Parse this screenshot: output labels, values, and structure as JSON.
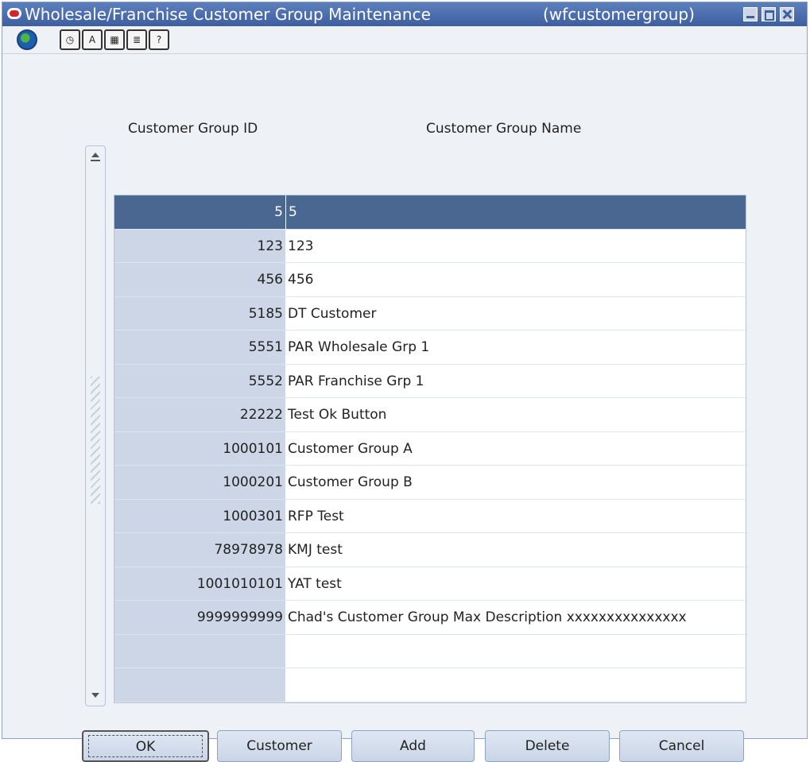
{
  "window": {
    "title": "Wholesale/Franchise Customer Group Maintenance",
    "form_id": "(wfcustomergroup)"
  },
  "toolbar": {
    "icons": [
      "globe-icon",
      "clock-icon",
      "font-icon",
      "calendar-icon",
      "notes-icon",
      "help-icon"
    ],
    "labels": [
      "◷",
      "A",
      "▦",
      "≣",
      "?"
    ]
  },
  "table": {
    "columns": [
      "Customer Group ID",
      "Customer Group Name"
    ],
    "rows": [
      {
        "id": "5",
        "name": "5"
      },
      {
        "id": "123",
        "name": "123"
      },
      {
        "id": "456",
        "name": "456"
      },
      {
        "id": "5185",
        "name": "DT Customer"
      },
      {
        "id": "5551",
        "name": "PAR Wholesale Grp 1"
      },
      {
        "id": "5552",
        "name": "PAR Franchise Grp 1"
      },
      {
        "id": "22222",
        "name": "Test Ok Button"
      },
      {
        "id": "1000101",
        "name": "Customer Group A"
      },
      {
        "id": "1000201",
        "name": "Customer Group B"
      },
      {
        "id": "1000301",
        "name": "RFP Test"
      },
      {
        "id": "78978978",
        "name": "KMJ test"
      },
      {
        "id": "1001010101",
        "name": "YAT test"
      },
      {
        "id": "9999999999",
        "name": "Chad's Customer Group Max Description xxxxxxxxxxxxxxx"
      },
      {
        "id": "",
        "name": ""
      },
      {
        "id": "",
        "name": ""
      }
    ],
    "selected_index": 0
  },
  "buttons": {
    "ok": "OK",
    "customer": "Customer",
    "add": "Add",
    "delete": "Delete",
    "cancel": "Cancel"
  },
  "colors": {
    "title_bar": "#3e5f9f",
    "selected_row": "#4a6791",
    "id_column": "#ccd6e6"
  }
}
